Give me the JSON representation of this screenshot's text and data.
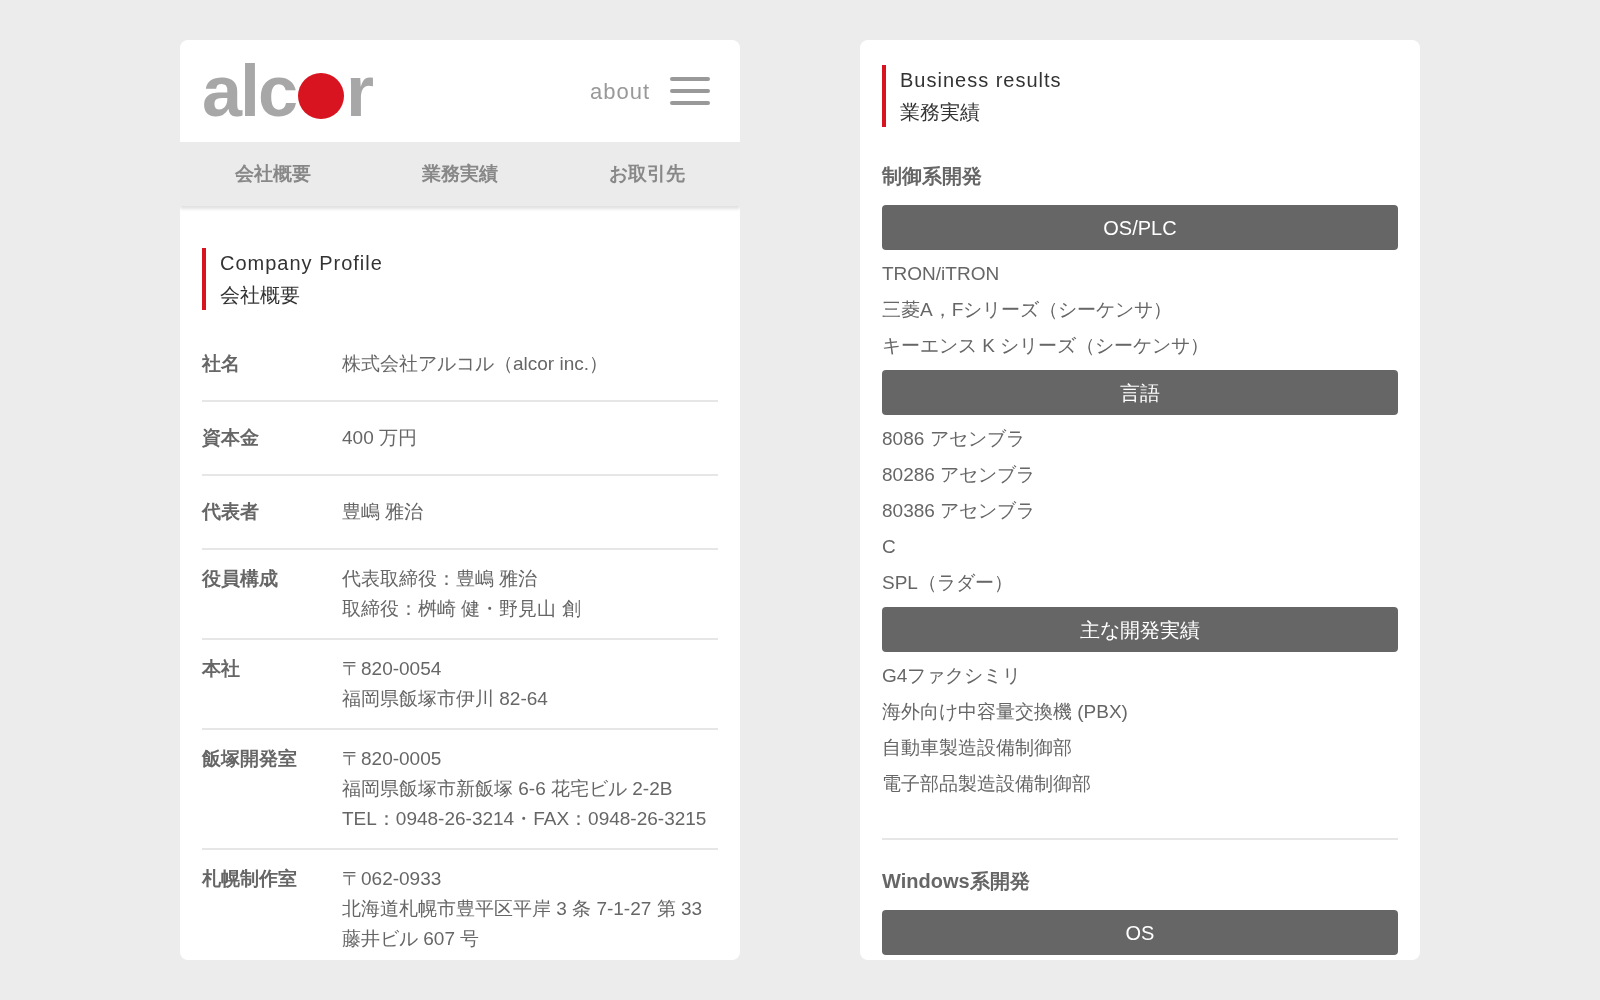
{
  "header": {
    "logo": [
      "alc",
      "r"
    ],
    "about": "about"
  },
  "tabs": [
    {
      "label": "会社概要"
    },
    {
      "label": "業務実績"
    },
    {
      "label": "お取引先"
    }
  ],
  "profile": {
    "title_en": "Company Profile",
    "title_ja": "会社概要",
    "rows": [
      {
        "label": "社名",
        "lines": [
          "株式会社アルコル（alcor inc.）"
        ]
      },
      {
        "label": "資本金",
        "lines": [
          "400 万円"
        ]
      },
      {
        "label": "代表者",
        "lines": [
          "豊嶋 雅治"
        ]
      },
      {
        "label": "役員構成",
        "lines": [
          "代表取締役：豊嶋 雅治",
          "取締役：桝崎 健・野見山 創"
        ]
      },
      {
        "label": "本社",
        "lines": [
          "〒820-0054",
          "福岡県飯塚市伊川 82-64"
        ]
      },
      {
        "label": "飯塚開発室",
        "lines": [
          "〒820-0005",
          "福岡県飯塚市新飯塚 6-6 花宅ビル 2-2B",
          "TEL：0948-26-3214・FAX：0948-26-3215"
        ]
      },
      {
        "label": "札幌制作室",
        "lines": [
          "〒062-0933",
          "北海道札幌市豊平区平岸 3 条 7-1-27 第 33",
          "藤井ビル 607 号"
        ]
      }
    ]
  },
  "results": {
    "title_en": "Business results",
    "title_ja": "業務実績",
    "sections": [
      {
        "title": "制御系開発",
        "groups": [
          {
            "title": "OS/PLC",
            "items": [
              "TRON/iTRON",
              "三菱A，Fシリーズ（シーケンサ）",
              "キーエンス K シリーズ（シーケンサ）"
            ]
          },
          {
            "title": "言語",
            "items": [
              "8086 アセンブラ",
              "80286 アセンブラ",
              "80386 アセンブラ",
              "C",
              "SPL（ラダー）"
            ]
          },
          {
            "title": "主な開発実績",
            "items": [
              "G4ファクシミリ",
              "海外向け中容量交換機 (PBX)",
              "自動車製造設備制御部",
              "電子部品製造設備制御部"
            ]
          }
        ]
      },
      {
        "title": "Windows系開発",
        "groups": [
          {
            "title": "OS"
          }
        ]
      }
    ]
  }
}
